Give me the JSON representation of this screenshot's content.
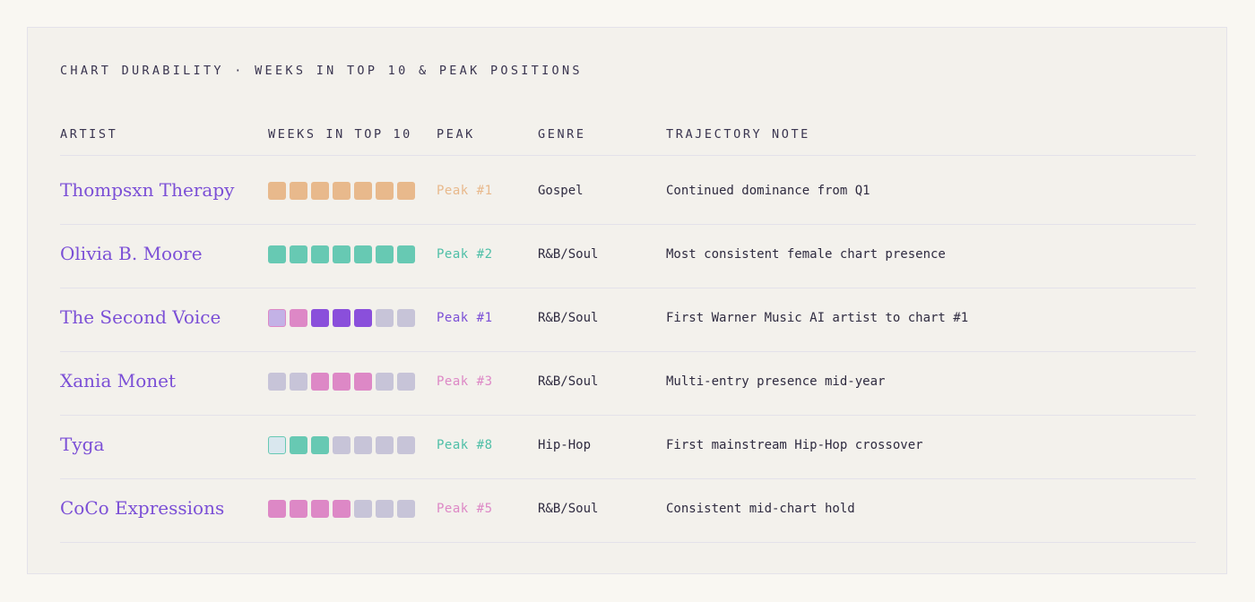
{
  "chart_data": {
    "type": "table",
    "title": "CHART DURABILITY · WEEKS IN TOP 10 & PEAK POSITIONS",
    "columns": [
      "ARTIST",
      "WEEKS IN TOP 10",
      "PEAK",
      "GENRE",
      "TRAJECTORY NOTE"
    ],
    "colors": {
      "orange": "#e8b98c",
      "teal": "#67c9b3",
      "purple": "#8a4fdb",
      "pink": "#dd88c6",
      "empty": "#c7c4d8",
      "light_purple_outlined": "#c3b2e6",
      "light_blue_outlined": "#d9e7ee",
      "accent": "#7b4fd6"
    },
    "rows": [
      {
        "artist": "Thompsxn Therapy",
        "weeks": [
          "orange",
          "orange",
          "orange",
          "orange",
          "orange",
          "orange",
          "orange"
        ],
        "peak": "Peak #1",
        "peak_color": "#e8b98c",
        "genre": "Gospel",
        "note": "Continued dominance from Q1"
      },
      {
        "artist": "Olivia B. Moore",
        "weeks": [
          "teal",
          "teal",
          "teal",
          "teal",
          "teal",
          "teal",
          "teal"
        ],
        "peak": "Peak #2",
        "peak_color": "#4fbfa7",
        "genre": "R&B/Soul",
        "note": "Most consistent female chart presence"
      },
      {
        "artist": "The Second Voice",
        "weeks": [
          "light_purple_outlined",
          "pink",
          "purple",
          "purple",
          "purple",
          "empty",
          "empty"
        ],
        "peak": "Peak #1",
        "peak_color": "#7b4fd6",
        "genre": "R&B/Soul",
        "note": "First Warner Music AI artist to chart #1"
      },
      {
        "artist": "Xania Monet",
        "weeks": [
          "empty",
          "empty",
          "pink",
          "pink",
          "pink",
          "empty",
          "empty"
        ],
        "peak": "Peak #3",
        "peak_color": "#dd88c6",
        "genre": "R&B/Soul",
        "note": "Multi-entry presence mid-year"
      },
      {
        "artist": "Tyga",
        "weeks": [
          "light_blue_outlined",
          "teal",
          "teal",
          "empty",
          "empty",
          "empty",
          "empty"
        ],
        "peak": "Peak #8",
        "peak_color": "#4fbfa7",
        "genre": "Hip-Hop",
        "note": "First mainstream Hip-Hop crossover"
      },
      {
        "artist": "CoCo Expressions",
        "weeks": [
          "pink",
          "pink",
          "pink",
          "pink",
          "empty",
          "empty",
          "empty"
        ],
        "peak": "Peak #5",
        "peak_color": "#dd88c6",
        "genre": "R&B/Soul",
        "note": "Consistent mid-chart hold"
      }
    ]
  }
}
